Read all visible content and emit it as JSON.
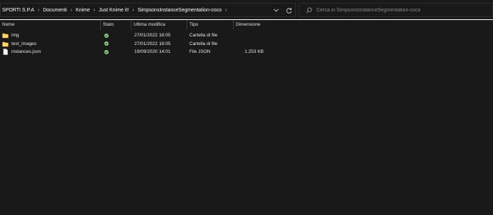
{
  "breadcrumb": [
    "SPORTI S.P.A",
    "Documenti",
    "Knime",
    "Just Knime it!",
    "SimpsonsInstanceSegmentation-coco"
  ],
  "search": {
    "placeholder": "Cerca in SimpsonsInstanceSegmentation-coco"
  },
  "columns": {
    "name": "Nome",
    "state": "Stato",
    "modified": "Ultima modifica",
    "type": "Tipo",
    "size": "Dimensione"
  },
  "files": [
    {
      "name": "img",
      "icon": "folder-icon",
      "modified": "27/01/2022 18:05",
      "type": "Cartella di file",
      "size": ""
    },
    {
      "name": "test_images",
      "icon": "folder-icon",
      "modified": "27/01/2022 18:05",
      "type": "Cartella di file",
      "size": ""
    },
    {
      "name": "instances.json",
      "icon": "file-icon",
      "modified": "19/09/2020 14:01",
      "type": "File JSON",
      "size": "1.253 KB"
    }
  ],
  "colors": {
    "background": "#191919",
    "folder": "#f4c54e",
    "status": "#8bd38b",
    "header_line": "#ffffff"
  }
}
